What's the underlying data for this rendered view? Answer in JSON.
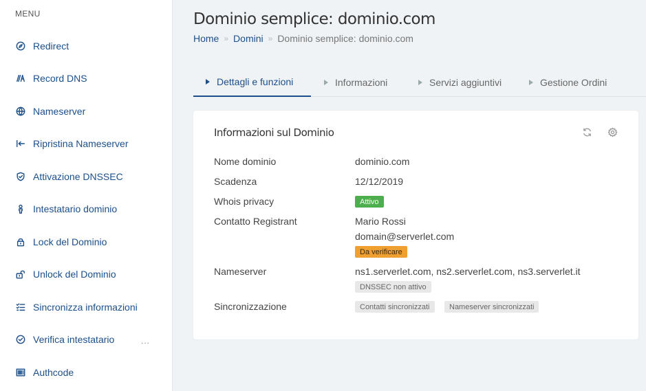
{
  "sidebar": {
    "menu_label": "MENU",
    "items": [
      {
        "label": "Redirect",
        "icon": "compass-icon"
      },
      {
        "label": "Record DNS",
        "icon": "record-dns-icon"
      },
      {
        "label": "Nameserver",
        "icon": "globe-icon"
      },
      {
        "label": "Ripristina Nameserver",
        "icon": "restore-icon"
      },
      {
        "label": "Attivazione DNSSEC",
        "icon": "shield-check-icon"
      },
      {
        "label": "Intestatario dominio",
        "icon": "person-icon"
      },
      {
        "label": "Lock del Dominio",
        "icon": "lock-icon"
      },
      {
        "label": "Unlock del Dominio",
        "icon": "unlock-icon"
      },
      {
        "label": "Sincronizza informazioni",
        "icon": "checklist-icon"
      },
      {
        "label": "Verifica intestatario",
        "icon": "check-circle-icon"
      },
      {
        "label": "Authcode",
        "icon": "barcode-icon"
      }
    ],
    "more": "..."
  },
  "header": {
    "title": "Dominio semplice: dominio.com",
    "breadcrumb": {
      "home": "Home",
      "sep": "»",
      "domini": "Domini",
      "current": "Dominio semplice: dominio.com"
    }
  },
  "tabs": [
    {
      "label": "Dettagli e funzioni",
      "active": true
    },
    {
      "label": "Informazioni",
      "active": false
    },
    {
      "label": "Servizi aggiuntivi",
      "active": false
    },
    {
      "label": "Gestione Ordini",
      "active": false
    }
  ],
  "card": {
    "title": "Informazioni sul Dominio",
    "icons": [
      "refresh-icon",
      "gear-icon"
    ],
    "rows": {
      "nome_dominio": {
        "label": "Nome dominio",
        "value": "dominio.com"
      },
      "scadenza": {
        "label": "Scadenza",
        "value": "12/12/2019"
      },
      "whois": {
        "label": "Whois privacy",
        "badge": "Attivo"
      },
      "contatto": {
        "label": "Contatto Registrant",
        "name": "Mario Rossi",
        "email": "domain@serverlet.com",
        "badge": "Da verificare"
      },
      "nameserver": {
        "label": "Nameserver",
        "value": "ns1.serverlet.com, ns2.serverlet.com, ns3.serverlet.it",
        "badge": "DNSSEC non attivo"
      },
      "sync": {
        "label": "Sincronizzazione",
        "badges": [
          "Contatti sincronizzati",
          "Nameserver sincronizzati"
        ]
      }
    }
  },
  "colors": {
    "link": "#1c4f8a",
    "badge_green": "#4cae4c",
    "badge_orange": "#f0a030",
    "background": "#f0f3f5"
  }
}
